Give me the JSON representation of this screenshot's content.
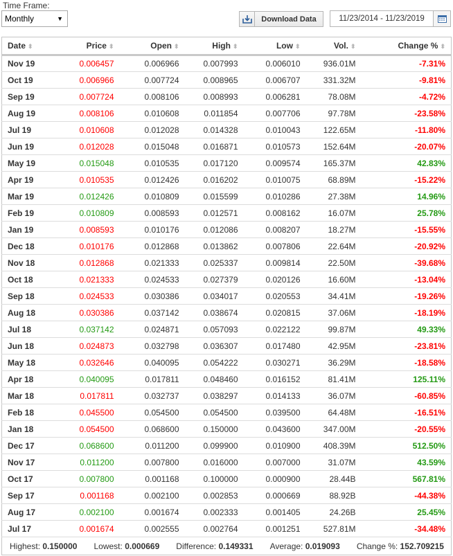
{
  "time_frame": {
    "label": "Time Frame:",
    "selected": "Monthly"
  },
  "toolbar": {
    "download_label": "Download Data",
    "download_icon": "download-icon",
    "date_range": "11/23/2014 - 11/23/2019",
    "calendar_icon": "calendar-icon"
  },
  "colors": {
    "negative": "#ff0000",
    "positive": "#249a14"
  },
  "table": {
    "headers": [
      "Date",
      "Price",
      "Open",
      "High",
      "Low",
      "Vol.",
      "Change %"
    ],
    "sort_icon": "sort-arrows-icon",
    "rows": [
      {
        "date": "Nov 19",
        "price": "0.006457",
        "open": "0.006966",
        "high": "0.007993",
        "low": "0.006010",
        "vol": "936.01M",
        "change": "-7.31%",
        "dir": "neg"
      },
      {
        "date": "Oct 19",
        "price": "0.006966",
        "open": "0.007724",
        "high": "0.008965",
        "low": "0.006707",
        "vol": "331.32M",
        "change": "-9.81%",
        "dir": "neg"
      },
      {
        "date": "Sep 19",
        "price": "0.007724",
        "open": "0.008106",
        "high": "0.008993",
        "low": "0.006281",
        "vol": "78.08M",
        "change": "-4.72%",
        "dir": "neg"
      },
      {
        "date": "Aug 19",
        "price": "0.008106",
        "open": "0.010608",
        "high": "0.011854",
        "low": "0.007706",
        "vol": "97.78M",
        "change": "-23.58%",
        "dir": "neg"
      },
      {
        "date": "Jul 19",
        "price": "0.010608",
        "open": "0.012028",
        "high": "0.014328",
        "low": "0.010043",
        "vol": "122.65M",
        "change": "-11.80%",
        "dir": "neg"
      },
      {
        "date": "Jun 19",
        "price": "0.012028",
        "open": "0.015048",
        "high": "0.016871",
        "low": "0.010573",
        "vol": "152.64M",
        "change": "-20.07%",
        "dir": "neg"
      },
      {
        "date": "May 19",
        "price": "0.015048",
        "open": "0.010535",
        "high": "0.017120",
        "low": "0.009574",
        "vol": "165.37M",
        "change": "42.83%",
        "dir": "pos"
      },
      {
        "date": "Apr 19",
        "price": "0.010535",
        "open": "0.012426",
        "high": "0.016202",
        "low": "0.010075",
        "vol": "68.89M",
        "change": "-15.22%",
        "dir": "neg"
      },
      {
        "date": "Mar 19",
        "price": "0.012426",
        "open": "0.010809",
        "high": "0.015599",
        "low": "0.010286",
        "vol": "27.38M",
        "change": "14.96%",
        "dir": "pos"
      },
      {
        "date": "Feb 19",
        "price": "0.010809",
        "open": "0.008593",
        "high": "0.012571",
        "low": "0.008162",
        "vol": "16.07M",
        "change": "25.78%",
        "dir": "pos"
      },
      {
        "date": "Jan 19",
        "price": "0.008593",
        "open": "0.010176",
        "high": "0.012086",
        "low": "0.008207",
        "vol": "18.27M",
        "change": "-15.55%",
        "dir": "neg"
      },
      {
        "date": "Dec 18",
        "price": "0.010176",
        "open": "0.012868",
        "high": "0.013862",
        "low": "0.007806",
        "vol": "22.64M",
        "change": "-20.92%",
        "dir": "neg"
      },
      {
        "date": "Nov 18",
        "price": "0.012868",
        "open": "0.021333",
        "high": "0.025337",
        "low": "0.009814",
        "vol": "22.50M",
        "change": "-39.68%",
        "dir": "neg"
      },
      {
        "date": "Oct 18",
        "price": "0.021333",
        "open": "0.024533",
        "high": "0.027379",
        "low": "0.020126",
        "vol": "16.60M",
        "change": "-13.04%",
        "dir": "neg"
      },
      {
        "date": "Sep 18",
        "price": "0.024533",
        "open": "0.030386",
        "high": "0.034017",
        "low": "0.020553",
        "vol": "34.41M",
        "change": "-19.26%",
        "dir": "neg"
      },
      {
        "date": "Aug 18",
        "price": "0.030386",
        "open": "0.037142",
        "high": "0.038674",
        "low": "0.020815",
        "vol": "37.06M",
        "change": "-18.19%",
        "dir": "neg"
      },
      {
        "date": "Jul 18",
        "price": "0.037142",
        "open": "0.024871",
        "high": "0.057093",
        "low": "0.022122",
        "vol": "99.87M",
        "change": "49.33%",
        "dir": "pos"
      },
      {
        "date": "Jun 18",
        "price": "0.024873",
        "open": "0.032798",
        "high": "0.036307",
        "low": "0.017480",
        "vol": "42.95M",
        "change": "-23.81%",
        "dir": "neg"
      },
      {
        "date": "May 18",
        "price": "0.032646",
        "open": "0.040095",
        "high": "0.054222",
        "low": "0.030271",
        "vol": "36.29M",
        "change": "-18.58%",
        "dir": "neg"
      },
      {
        "date": "Apr 18",
        "price": "0.040095",
        "open": "0.017811",
        "high": "0.048460",
        "low": "0.016152",
        "vol": "81.41M",
        "change": "125.11%",
        "dir": "pos"
      },
      {
        "date": "Mar 18",
        "price": "0.017811",
        "open": "0.032737",
        "high": "0.038297",
        "low": "0.014133",
        "vol": "36.07M",
        "change": "-60.85%",
        "dir": "neg"
      },
      {
        "date": "Feb 18",
        "price": "0.045500",
        "open": "0.054500",
        "high": "0.054500",
        "low": "0.039500",
        "vol": "64.48M",
        "change": "-16.51%",
        "dir": "neg"
      },
      {
        "date": "Jan 18",
        "price": "0.054500",
        "open": "0.068600",
        "high": "0.150000",
        "low": "0.043600",
        "vol": "347.00M",
        "change": "-20.55%",
        "dir": "neg"
      },
      {
        "date": "Dec 17",
        "price": "0.068600",
        "open": "0.011200",
        "high": "0.099900",
        "low": "0.010900",
        "vol": "408.39M",
        "change": "512.50%",
        "dir": "pos"
      },
      {
        "date": "Nov 17",
        "price": "0.011200",
        "open": "0.007800",
        "high": "0.016000",
        "low": "0.007000",
        "vol": "31.07M",
        "change": "43.59%",
        "dir": "pos"
      },
      {
        "date": "Oct 17",
        "price": "0.007800",
        "open": "0.001168",
        "high": "0.100000",
        "low": "0.000900",
        "vol": "28.44B",
        "change": "567.81%",
        "dir": "pos"
      },
      {
        "date": "Sep 17",
        "price": "0.001168",
        "open": "0.002100",
        "high": "0.002853",
        "low": "0.000669",
        "vol": "88.92B",
        "change": "-44.38%",
        "dir": "neg"
      },
      {
        "date": "Aug 17",
        "price": "0.002100",
        "open": "0.001674",
        "high": "0.002333",
        "low": "0.001405",
        "vol": "24.26B",
        "change": "25.45%",
        "dir": "pos"
      },
      {
        "date": "Jul 17",
        "price": "0.001674",
        "open": "0.002555",
        "high": "0.002764",
        "low": "0.001251",
        "vol": "527.81M",
        "change": "-34.48%",
        "dir": "neg"
      }
    ]
  },
  "summary": {
    "highest_label": "Highest:",
    "highest": "0.150000",
    "lowest_label": "Lowest:",
    "lowest": "0.000669",
    "difference_label": "Difference:",
    "difference": "0.149331",
    "average_label": "Average:",
    "average": "0.019093",
    "change_label": "Change %:",
    "change": "152.709215"
  }
}
